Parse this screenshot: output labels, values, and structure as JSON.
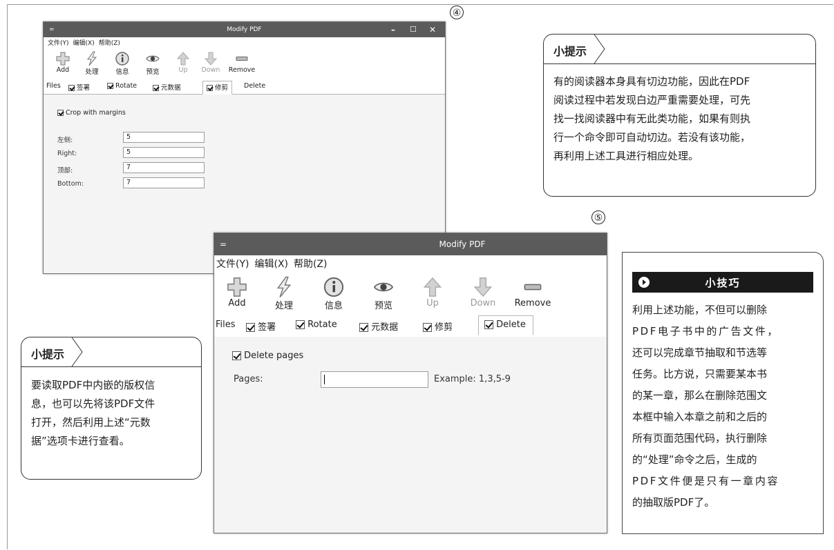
{
  "figure_numbers": {
    "first": "④",
    "second": "⑤"
  },
  "window_small": {
    "menu_icon": "=",
    "title": "Modify PDF",
    "controls": {
      "minimize": "–",
      "maximize": "☐",
      "close": "✕"
    },
    "menus": [
      "文件(Y)",
      "编辑(X)",
      "帮助(Z)"
    ],
    "toolbar": [
      "Add",
      "处理",
      "信息",
      "预览",
      "Up",
      "Down",
      "Remove"
    ],
    "tabs": {
      "files": "Files",
      "t1": "签署",
      "t2": "Rotate",
      "t3": "元数据",
      "t4": "修剪",
      "t5": "Delete"
    },
    "crop_label": "Crop with margins",
    "fields": [
      {
        "label": "左侧:",
        "value": "5"
      },
      {
        "label": "Right:",
        "value": "5"
      },
      {
        "label": "顶部:",
        "value": "7"
      },
      {
        "label": "Bottom:",
        "value": "7"
      }
    ]
  },
  "window_large": {
    "menu_icon": "=",
    "title": "Modify PDF",
    "menus": [
      "文件(Y)",
      "编辑(X)",
      "帮助(Z)"
    ],
    "toolbar": [
      "Add",
      "处理",
      "信息",
      "预览",
      "Up",
      "Down",
      "Remove"
    ],
    "tabs": {
      "files": "Files",
      "t1": "签署",
      "t2": "Rotate",
      "t3": "元数据",
      "t4": "修剪",
      "t5": "Delete"
    },
    "delete_pages_label": "Delete pages",
    "pages_label": "Pages:",
    "pages_value": "",
    "example": "Example: 1,3,5-9"
  },
  "tip_top_right": {
    "heading": "小提示",
    "lines": [
      "有的阅读器本身具有切边功能，因此在PDF",
      "阅读过程中若发现白边严重需要处理，可先",
      "找一找阅读器中有无此类功能，如果有则执",
      "行一个命令即可自动切边。若没有该功能，",
      "再利用上述工具进行相应处理。"
    ]
  },
  "tip_bottom_left": {
    "heading": "小提示",
    "lines": [
      "要读取PDF中内嵌的版权信",
      "息，也可以先将该PDF文件",
      "打开，然后利用上述“元数",
      "据”选项卡进行查看。"
    ]
  },
  "trick": {
    "heading": "小技巧",
    "lines": [
      "利用上述功能，不但可以删除",
      "PDF电子书中的广告文件，",
      "还可以完成章节抽取和节选等",
      "任务。比方说，只需要某本书",
      "的某一章，那么在删除范围文",
      "本框中输入本章之前和之后的",
      "所有页面范围代码，执行删除",
      "的“处理”命令之后，生成的",
      "PDF文件便是只有一章内容",
      "的抽取版PDF了。"
    ]
  }
}
